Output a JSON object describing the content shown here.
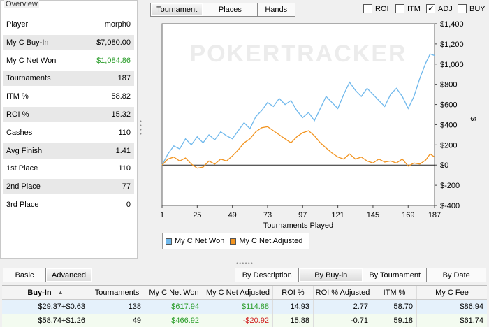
{
  "overview": {
    "title": "Overview",
    "rows": [
      {
        "label": "Player",
        "value": "morph0"
      },
      {
        "label": "My C Buy-In",
        "value": "$7,080.00"
      },
      {
        "label": "My C Net Won",
        "value": "$1,084.86"
      },
      {
        "label": "Tournaments",
        "value": "187"
      },
      {
        "label": "ITM %",
        "value": "58.82"
      },
      {
        "label": "ROI %",
        "value": "15.32"
      },
      {
        "label": "Cashes",
        "value": "110"
      },
      {
        "label": "Avg Finish",
        "value": "1.41"
      },
      {
        "label": "1st Place",
        "value": "110"
      },
      {
        "label": "2nd Place",
        "value": "77"
      },
      {
        "label": "3rd Place",
        "value": "0"
      }
    ],
    "positive_color": "#2a9d2a"
  },
  "chart_tabs": [
    "Tournament",
    "Places",
    "Hands"
  ],
  "active_chart_tab": "Tournament",
  "checkboxes": [
    {
      "label": "ROI",
      "checked": false
    },
    {
      "label": "ITM",
      "checked": false
    },
    {
      "label": "ADJ",
      "checked": true
    },
    {
      "label": "BUY",
      "checked": false
    }
  ],
  "chart_data": {
    "type": "line",
    "watermark": "POKERTRACKER",
    "xlabel": "Tournaments Played",
    "ylabel": "$",
    "xlim": [
      1,
      187
    ],
    "ylim": [
      -400,
      1400
    ],
    "x_ticks": [
      1,
      25,
      49,
      73,
      97,
      121,
      145,
      169,
      187
    ],
    "y_ticks": [
      -400,
      -200,
      0,
      200,
      400,
      600,
      800,
      1000,
      1200,
      1400
    ],
    "y_tick_labels": [
      "$-400",
      "$-200",
      "$0",
      "$200",
      "$400",
      "$600",
      "$800",
      "$1,000",
      "$1,200",
      "$1,400"
    ],
    "grid": false,
    "legend_position": "bottom-left",
    "series": [
      {
        "name": "My C Net Won",
        "color": "#6fb8ec",
        "points": [
          [
            1,
            0
          ],
          [
            5,
            110
          ],
          [
            9,
            190
          ],
          [
            13,
            160
          ],
          [
            17,
            260
          ],
          [
            21,
            200
          ],
          [
            25,
            280
          ],
          [
            29,
            220
          ],
          [
            33,
            300
          ],
          [
            37,
            250
          ],
          [
            41,
            330
          ],
          [
            45,
            290
          ],
          [
            49,
            260
          ],
          [
            53,
            340
          ],
          [
            57,
            420
          ],
          [
            61,
            360
          ],
          [
            65,
            480
          ],
          [
            69,
            540
          ],
          [
            73,
            620
          ],
          [
            77,
            580
          ],
          [
            81,
            660
          ],
          [
            85,
            600
          ],
          [
            89,
            640
          ],
          [
            93,
            540
          ],
          [
            97,
            470
          ],
          [
            101,
            520
          ],
          [
            105,
            440
          ],
          [
            109,
            560
          ],
          [
            113,
            680
          ],
          [
            117,
            620
          ],
          [
            121,
            560
          ],
          [
            125,
            700
          ],
          [
            129,
            820
          ],
          [
            133,
            740
          ],
          [
            137,
            680
          ],
          [
            141,
            760
          ],
          [
            145,
            700
          ],
          [
            149,
            640
          ],
          [
            153,
            580
          ],
          [
            157,
            700
          ],
          [
            161,
            760
          ],
          [
            165,
            680
          ],
          [
            169,
            560
          ],
          [
            173,
            680
          ],
          [
            177,
            860
          ],
          [
            181,
            1010
          ],
          [
            184,
            1100
          ],
          [
            187,
            1085
          ]
        ]
      },
      {
        "name": "My C Net Adjusted",
        "color": "#f29420",
        "points": [
          [
            1,
            0
          ],
          [
            5,
            60
          ],
          [
            9,
            80
          ],
          [
            13,
            40
          ],
          [
            17,
            70
          ],
          [
            21,
            10
          ],
          [
            25,
            -30
          ],
          [
            29,
            -20
          ],
          [
            33,
            40
          ],
          [
            37,
            10
          ],
          [
            41,
            60
          ],
          [
            45,
            40
          ],
          [
            49,
            90
          ],
          [
            53,
            150
          ],
          [
            57,
            220
          ],
          [
            61,
            260
          ],
          [
            65,
            330
          ],
          [
            69,
            370
          ],
          [
            73,
            380
          ],
          [
            77,
            340
          ],
          [
            81,
            300
          ],
          [
            85,
            260
          ],
          [
            89,
            220
          ],
          [
            93,
            280
          ],
          [
            97,
            320
          ],
          [
            101,
            340
          ],
          [
            105,
            290
          ],
          [
            109,
            220
          ],
          [
            113,
            170
          ],
          [
            117,
            120
          ],
          [
            121,
            80
          ],
          [
            125,
            60
          ],
          [
            129,
            110
          ],
          [
            133,
            60
          ],
          [
            137,
            80
          ],
          [
            141,
            40
          ],
          [
            145,
            20
          ],
          [
            149,
            60
          ],
          [
            153,
            30
          ],
          [
            157,
            40
          ],
          [
            161,
            20
          ],
          [
            165,
            60
          ],
          [
            169,
            -10
          ],
          [
            173,
            20
          ],
          [
            177,
            10
          ],
          [
            181,
            50
          ],
          [
            184,
            110
          ],
          [
            187,
            80
          ]
        ]
      }
    ]
  },
  "legend": [
    "My C Net Won",
    "My C Net Adjusted"
  ],
  "view_tabs": [
    "Basic",
    "Advanced"
  ],
  "active_view_tab": "Advanced",
  "group_tabs": [
    "By Description",
    "By Buy-in",
    "By Tournament",
    "By Date"
  ],
  "active_group_tab": "By Buy-in",
  "table": {
    "sort_indicator": "▲",
    "columns": [
      "Buy-In",
      "Tournaments",
      "My C Net Won",
      "My C Net Adjusted",
      "ROI %",
      "ROI % Adjusted",
      "ITM %",
      "My C Fee"
    ],
    "rows": [
      [
        "$29.37+$0.63",
        "138",
        "$617.94",
        "$114.88",
        "14.93",
        "2.77",
        "58.70",
        "$86.94"
      ],
      [
        "$58.74+$1.26",
        "49",
        "$466.92",
        "-$20.92",
        "15.88",
        "-0.71",
        "59.18",
        "$61.74"
      ]
    ],
    "negative_color": "#d02020"
  }
}
